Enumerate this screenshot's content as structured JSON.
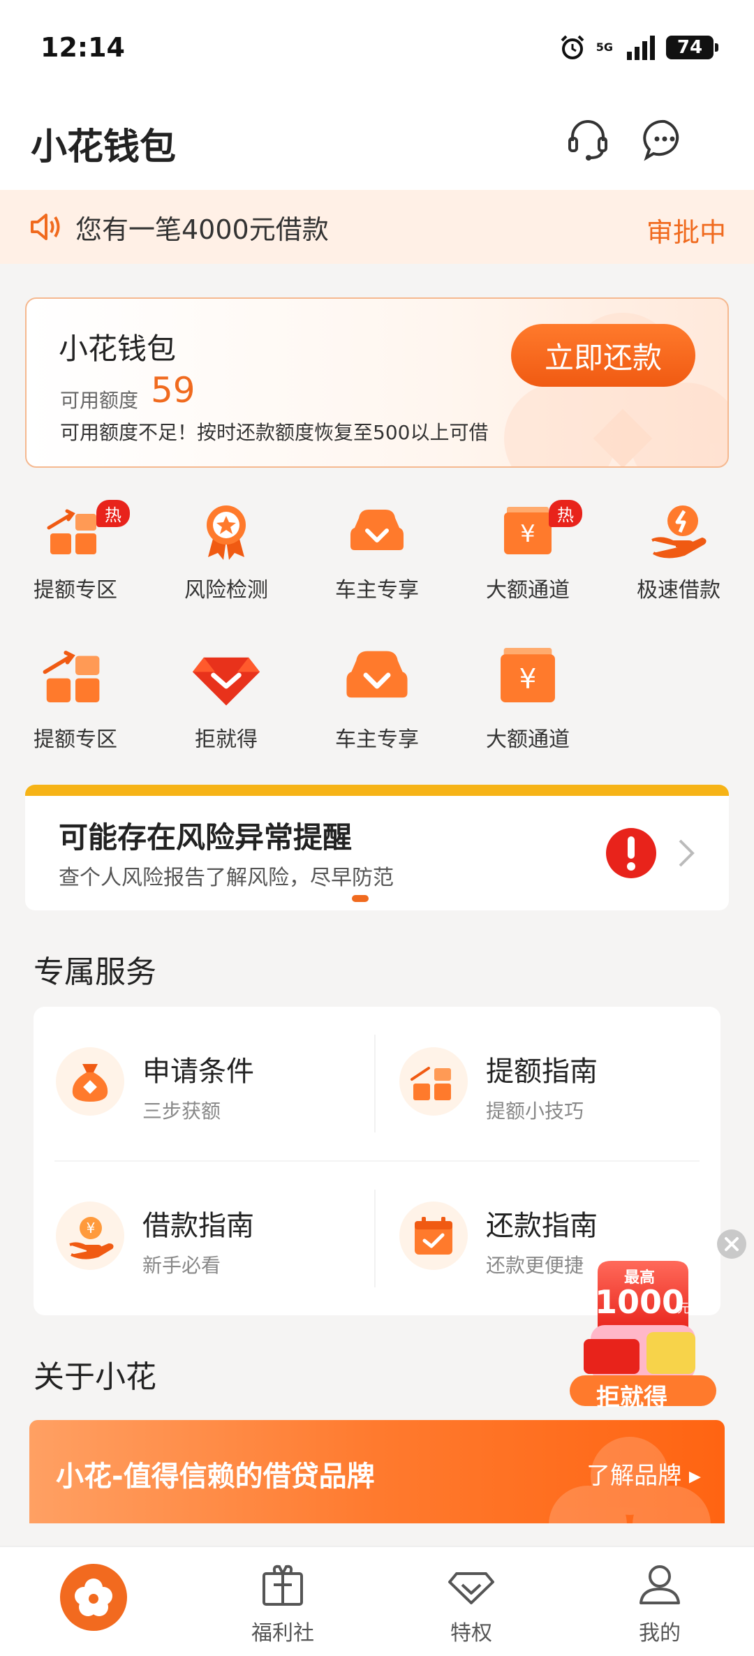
{
  "status_bar": {
    "time": "12:14",
    "network": "5G",
    "battery": "74"
  },
  "header": {
    "title": "小花钱包"
  },
  "notice": {
    "text": "您有一笔4000元借款",
    "status": "审批中"
  },
  "wallet": {
    "name": "小花钱包",
    "limit_label": "可用额度",
    "limit_value": "59",
    "tip": "可用额度不足！按时还款额度恢复至500以上可借",
    "repay_button": "立即还款"
  },
  "grid": {
    "hot_badge": "热",
    "items": [
      {
        "label": "提额专区",
        "icon": "credit-up-icon",
        "hot": true
      },
      {
        "label": "风险检测",
        "icon": "medal-icon",
        "hot": false
      },
      {
        "label": "车主专享",
        "icon": "car-icon",
        "hot": false
      },
      {
        "label": "大额通道",
        "icon": "yuan-box-icon",
        "hot": true
      },
      {
        "label": "极速借款",
        "icon": "lightning-hand-icon",
        "hot": false
      },
      {
        "label": "提额专区",
        "icon": "credit-up-icon",
        "hot": false
      },
      {
        "label": "拒就得",
        "icon": "gem-icon",
        "hot": false
      },
      {
        "label": "车主专享",
        "icon": "car-icon",
        "hot": false
      },
      {
        "label": "大额通道",
        "icon": "yuan-box-icon",
        "hot": false
      }
    ]
  },
  "risk": {
    "title": "可能存在风险异常提醒",
    "subtitle": "查个人风险报告了解风险，尽早防范"
  },
  "services": {
    "title": "专属服务",
    "items": [
      {
        "title": "申请条件",
        "subtitle": "三步获额",
        "icon": "money-bag-icon"
      },
      {
        "title": "提额指南",
        "subtitle": "提额小技巧",
        "icon": "credit-up-icon"
      },
      {
        "title": "借款指南",
        "subtitle": "新手必看",
        "icon": "coin-hand-icon"
      },
      {
        "title": "还款指南",
        "subtitle": "还款更便捷",
        "icon": "calendar-check-icon"
      }
    ]
  },
  "promo": {
    "top": "最高",
    "amount": "1000",
    "unit": "元",
    "label": "拒就得"
  },
  "about": {
    "title": "关于小花",
    "banner_text": "小花-值得信赖的借贷品牌",
    "banner_link": "了解品牌 ▸"
  },
  "tabbar": {
    "items": [
      {
        "label": ""
      },
      {
        "label": "福利社"
      },
      {
        "label": "特权"
      },
      {
        "label": "我的"
      }
    ]
  },
  "colors": {
    "accent": "#f06a1e",
    "hot": "#e8231b",
    "risk_bar": "#f6b316",
    "notice_bg": "#fff0e6"
  }
}
